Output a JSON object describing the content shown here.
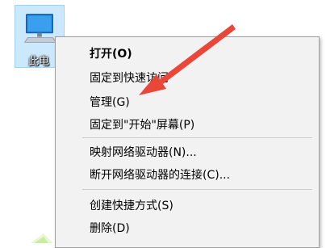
{
  "desktop": {
    "icon_label": "此电",
    "icon_name": "this-pc-icon"
  },
  "context_menu": {
    "items": [
      {
        "label": "打开(O)",
        "bold": true
      },
      {
        "label": "固定到快速访问"
      },
      {
        "label": "管理(G)"
      },
      {
        "label": "固定到\"开始\"屏幕(P)"
      },
      {
        "label": "映射网络驱动器(N)..."
      },
      {
        "label": "断开网络驱动器的连接(C)..."
      },
      {
        "label": "创建快捷方式(S)"
      },
      {
        "label": "删除(D)"
      }
    ]
  },
  "annotation": {
    "arrow_color": "#e8473a"
  },
  "colors": {
    "selection_fill": "#cce8ff",
    "selection_border": "#99d1ff",
    "menu_background": "#f2f2f2",
    "menu_border": "#a0a0a0"
  }
}
